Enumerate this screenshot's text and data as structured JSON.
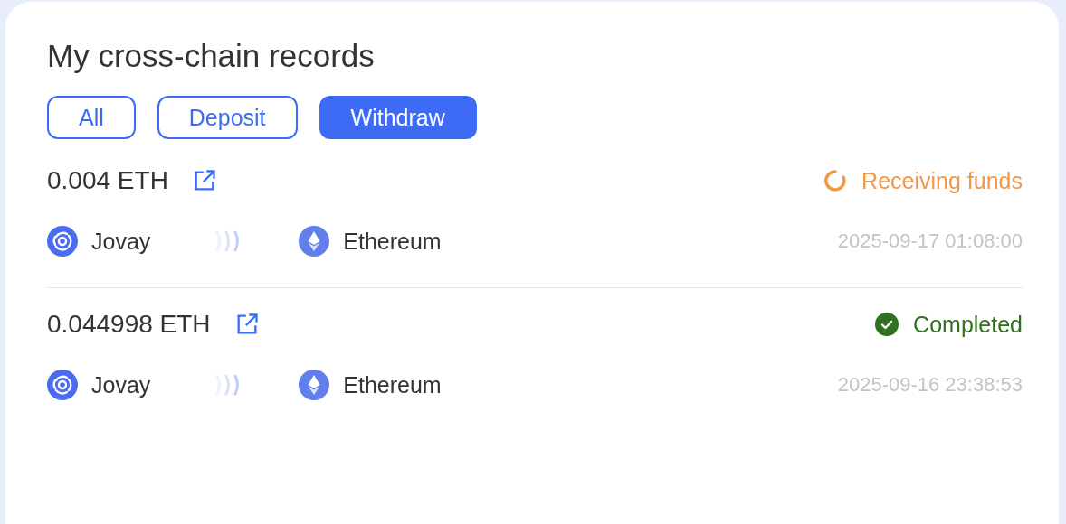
{
  "title": "My cross-chain records",
  "tabs": [
    {
      "label": "All",
      "selected": false
    },
    {
      "label": "Deposit",
      "selected": false
    },
    {
      "label": "Withdraw",
      "selected": true
    }
  ],
  "records": [
    {
      "amount": "0.004 ETH",
      "status": {
        "kind": "pending",
        "label": "Receiving funds"
      },
      "from": "Jovay",
      "to": "Ethereum",
      "time": "2025-09-17 01:08:00"
    },
    {
      "amount": "0.044998 ETH",
      "status": {
        "kind": "completed",
        "label": "Completed"
      },
      "from": "Jovay",
      "to": "Ethereum",
      "time": "2025-09-16 23:38:53"
    }
  ]
}
